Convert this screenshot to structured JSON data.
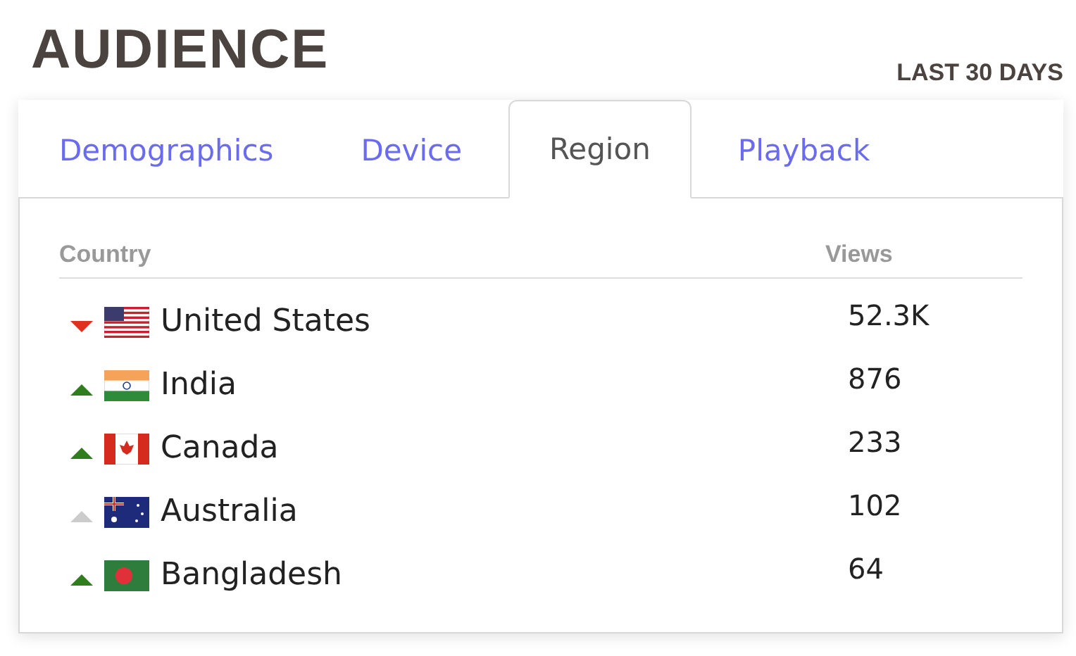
{
  "title": "AUDIENCE",
  "period": "LAST 30 DAYS",
  "tabs": [
    {
      "label": "Demographics",
      "selected": false
    },
    {
      "label": "Device",
      "selected": false
    },
    {
      "label": "Region",
      "selected": true
    },
    {
      "label": "Playback",
      "selected": false
    }
  ],
  "table": {
    "columns": [
      "Country",
      "Views"
    ],
    "rows": [
      {
        "trend": {
          "kind": "down"
        },
        "flag": {
          "kind": "us"
        },
        "country": "United States",
        "views": "52.3K"
      },
      {
        "trend": {
          "kind": "up"
        },
        "flag": {
          "kind": "in"
        },
        "country": "India",
        "views": "876"
      },
      {
        "trend": {
          "kind": "up"
        },
        "flag": {
          "kind": "ca"
        },
        "country": "Canada",
        "views": "233"
      },
      {
        "trend": {
          "kind": "flat"
        },
        "flag": {
          "kind": "au"
        },
        "country": "Australia",
        "views": "102"
      },
      {
        "trend": {
          "kind": "up"
        },
        "flag": {
          "kind": "bd"
        },
        "country": "Bangladesh",
        "views": "64"
      }
    ]
  }
}
